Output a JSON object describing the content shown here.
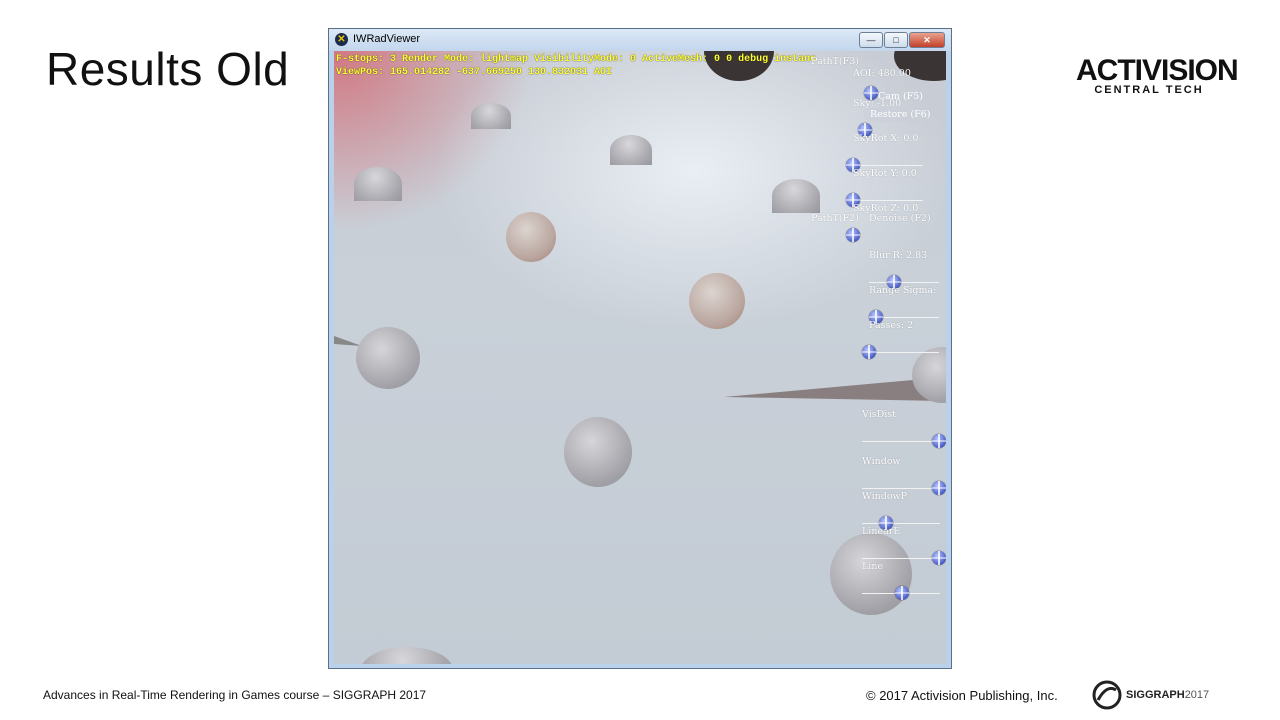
{
  "slide": {
    "title": "Results Old",
    "footer_left": "Advances in Real-Time Rendering in Games course – SIGGRAPH 2017",
    "footer_right": "© 2017 Activision Publishing, Inc.",
    "logo_main": "ACTIVISION",
    "logo_sub": "CENTRAL TECH",
    "siggraph_main": "SIGGRAPH",
    "siggraph_year": "2017"
  },
  "window": {
    "title": "IWRadViewer",
    "minimize_symbol": "—",
    "maximize_symbol": "□",
    "close_symbol": "✕"
  },
  "hud": {
    "line1": "F-stops: 3 Render Mode: lightmap VisibilityMode: 0 ActiveMesh: 0 0 debug instanc",
    "line2": "ViewPos: 165.014282 -637.669250 130.832031 AOI"
  },
  "panel": {
    "patht_f3": "PathT(F3)",
    "aoi": "AOI: 480.00",
    "cam_f5": "Cam (F5)",
    "sky": "Sky: -1.00",
    "restore_f6": "Restore (F6)",
    "skyrot_x": "SkyRot X: 0.0",
    "skyrot_y": "SkyRot Y: 0.0",
    "skyrot_z": "SkyRot Z: 0.0",
    "patht_f2": "PathT(F2)",
    "denoise_f2": "Denoise (F2)",
    "blur_r": "Blur R: 2.83",
    "range_sigma": "Range Sigma:",
    "passes": "Passes: 2",
    "visdist": "VisDist",
    "window": "Window",
    "windowp": "WindowP",
    "lineare": "LinearE",
    "line": "Line"
  }
}
